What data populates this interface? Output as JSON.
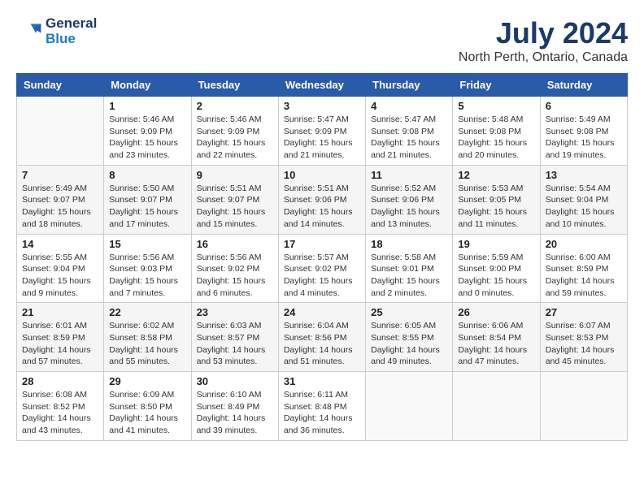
{
  "header": {
    "logo_line1": "General",
    "logo_line2": "Blue",
    "title": "July 2024",
    "subtitle": "North Perth, Ontario, Canada"
  },
  "columns": [
    "Sunday",
    "Monday",
    "Tuesday",
    "Wednesday",
    "Thursday",
    "Friday",
    "Saturday"
  ],
  "weeks": [
    [
      {
        "day": "",
        "info": ""
      },
      {
        "day": "1",
        "info": "Sunrise: 5:46 AM\nSunset: 9:09 PM\nDaylight: 15 hours\nand 23 minutes."
      },
      {
        "day": "2",
        "info": "Sunrise: 5:46 AM\nSunset: 9:09 PM\nDaylight: 15 hours\nand 22 minutes."
      },
      {
        "day": "3",
        "info": "Sunrise: 5:47 AM\nSunset: 9:09 PM\nDaylight: 15 hours\nand 21 minutes."
      },
      {
        "day": "4",
        "info": "Sunrise: 5:47 AM\nSunset: 9:08 PM\nDaylight: 15 hours\nand 21 minutes."
      },
      {
        "day": "5",
        "info": "Sunrise: 5:48 AM\nSunset: 9:08 PM\nDaylight: 15 hours\nand 20 minutes."
      },
      {
        "day": "6",
        "info": "Sunrise: 5:49 AM\nSunset: 9:08 PM\nDaylight: 15 hours\nand 19 minutes."
      }
    ],
    [
      {
        "day": "7",
        "info": "Sunrise: 5:49 AM\nSunset: 9:07 PM\nDaylight: 15 hours\nand 18 minutes."
      },
      {
        "day": "8",
        "info": "Sunrise: 5:50 AM\nSunset: 9:07 PM\nDaylight: 15 hours\nand 17 minutes."
      },
      {
        "day": "9",
        "info": "Sunrise: 5:51 AM\nSunset: 9:07 PM\nDaylight: 15 hours\nand 15 minutes."
      },
      {
        "day": "10",
        "info": "Sunrise: 5:51 AM\nSunset: 9:06 PM\nDaylight: 15 hours\nand 14 minutes."
      },
      {
        "day": "11",
        "info": "Sunrise: 5:52 AM\nSunset: 9:06 PM\nDaylight: 15 hours\nand 13 minutes."
      },
      {
        "day": "12",
        "info": "Sunrise: 5:53 AM\nSunset: 9:05 PM\nDaylight: 15 hours\nand 11 minutes."
      },
      {
        "day": "13",
        "info": "Sunrise: 5:54 AM\nSunset: 9:04 PM\nDaylight: 15 hours\nand 10 minutes."
      }
    ],
    [
      {
        "day": "14",
        "info": "Sunrise: 5:55 AM\nSunset: 9:04 PM\nDaylight: 15 hours\nand 9 minutes."
      },
      {
        "day": "15",
        "info": "Sunrise: 5:56 AM\nSunset: 9:03 PM\nDaylight: 15 hours\nand 7 minutes."
      },
      {
        "day": "16",
        "info": "Sunrise: 5:56 AM\nSunset: 9:02 PM\nDaylight: 15 hours\nand 6 minutes."
      },
      {
        "day": "17",
        "info": "Sunrise: 5:57 AM\nSunset: 9:02 PM\nDaylight: 15 hours\nand 4 minutes."
      },
      {
        "day": "18",
        "info": "Sunrise: 5:58 AM\nSunset: 9:01 PM\nDaylight: 15 hours\nand 2 minutes."
      },
      {
        "day": "19",
        "info": "Sunrise: 5:59 AM\nSunset: 9:00 PM\nDaylight: 15 hours\nand 0 minutes."
      },
      {
        "day": "20",
        "info": "Sunrise: 6:00 AM\nSunset: 8:59 PM\nDaylight: 14 hours\nand 59 minutes."
      }
    ],
    [
      {
        "day": "21",
        "info": "Sunrise: 6:01 AM\nSunset: 8:59 PM\nDaylight: 14 hours\nand 57 minutes."
      },
      {
        "day": "22",
        "info": "Sunrise: 6:02 AM\nSunset: 8:58 PM\nDaylight: 14 hours\nand 55 minutes."
      },
      {
        "day": "23",
        "info": "Sunrise: 6:03 AM\nSunset: 8:57 PM\nDaylight: 14 hours\nand 53 minutes."
      },
      {
        "day": "24",
        "info": "Sunrise: 6:04 AM\nSunset: 8:56 PM\nDaylight: 14 hours\nand 51 minutes."
      },
      {
        "day": "25",
        "info": "Sunrise: 6:05 AM\nSunset: 8:55 PM\nDaylight: 14 hours\nand 49 minutes."
      },
      {
        "day": "26",
        "info": "Sunrise: 6:06 AM\nSunset: 8:54 PM\nDaylight: 14 hours\nand 47 minutes."
      },
      {
        "day": "27",
        "info": "Sunrise: 6:07 AM\nSunset: 8:53 PM\nDaylight: 14 hours\nand 45 minutes."
      }
    ],
    [
      {
        "day": "28",
        "info": "Sunrise: 6:08 AM\nSunset: 8:52 PM\nDaylight: 14 hours\nand 43 minutes."
      },
      {
        "day": "29",
        "info": "Sunrise: 6:09 AM\nSunset: 8:50 PM\nDaylight: 14 hours\nand 41 minutes."
      },
      {
        "day": "30",
        "info": "Sunrise: 6:10 AM\nSunset: 8:49 PM\nDaylight: 14 hours\nand 39 minutes."
      },
      {
        "day": "31",
        "info": "Sunrise: 6:11 AM\nSunset: 8:48 PM\nDaylight: 14 hours\nand 36 minutes."
      },
      {
        "day": "",
        "info": ""
      },
      {
        "day": "",
        "info": ""
      },
      {
        "day": "",
        "info": ""
      }
    ]
  ]
}
